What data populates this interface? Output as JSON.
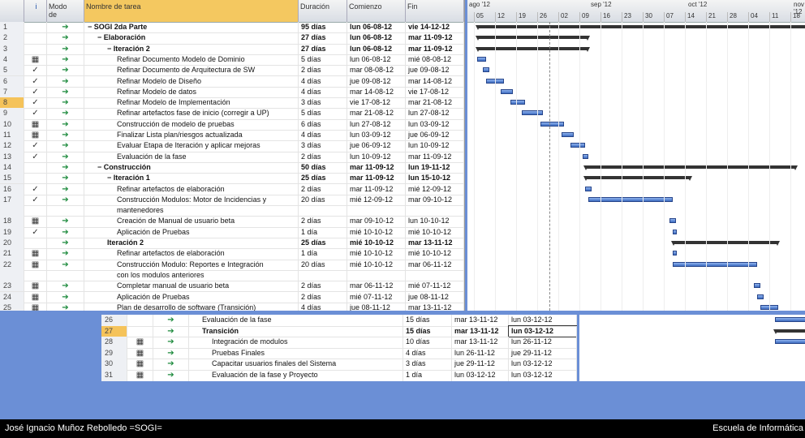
{
  "headers": {
    "info": "i",
    "mode": "Modo\nde",
    "name": "Nombre de tarea",
    "duration": "Duración",
    "start": "Comienzo",
    "end": "Fin"
  },
  "months": [
    "ago '12",
    "sep '12",
    "oct '12",
    "nov '12"
  ],
  "weeks": [
    "05",
    "12",
    "19",
    "26",
    "02",
    "09",
    "16",
    "23",
    "30",
    "07",
    "14",
    "21",
    "28",
    "04",
    "11",
    "18"
  ],
  "rows": [
    {
      "id": "1",
      "mark": "",
      "name": "− SOGI 2da Parte",
      "dur": "95 días",
      "start": "lun 06-08-12",
      "end": "vie 14-12-12",
      "level": 0,
      "sum": true
    },
    {
      "id": "2",
      "mark": "",
      "name": "− Elaboración",
      "dur": "27 días",
      "start": "lun 06-08-12",
      "end": "mar 11-09-12",
      "level": 1,
      "sum": true
    },
    {
      "id": "3",
      "mark": "",
      "name": "− Iteración 2",
      "dur": "27 días",
      "start": "lun 06-08-12",
      "end": "mar 11-09-12",
      "level": 2,
      "sum": true
    },
    {
      "id": "4",
      "mark": "▦",
      "name": "Refinar Documento Modelo de Dominio",
      "dur": "5 días",
      "start": "lun 06-08-12",
      "end": "mié 08-08-12",
      "level": 3
    },
    {
      "id": "5",
      "mark": "✓",
      "name": "Refinar Documento de Arquitectura de SW",
      "dur": "2 días",
      "start": "mar 08-08-12",
      "end": "jue 09-08-12",
      "level": 3
    },
    {
      "id": "6",
      "mark": "✓",
      "name": "Refinar Modelo de Diseño",
      "dur": "4 días",
      "start": "jue 09-08-12",
      "end": "mar 14-08-12",
      "level": 3
    },
    {
      "id": "7",
      "mark": "✓",
      "name": "Refinar Modelo de datos",
      "dur": "4 días",
      "start": "mar 14-08-12",
      "end": "vie 17-08-12",
      "level": 3
    },
    {
      "id": "8",
      "mark": "✓",
      "name": "Refinar Modelo de Implementación",
      "dur": "3 días",
      "start": "vie 17-08-12",
      "end": "mar 21-08-12",
      "level": 3,
      "cur": true
    },
    {
      "id": "9",
      "mark": "✓",
      "name": "Refinar artefactos fase de inicio (corregir a UP)",
      "dur": "5 días",
      "start": "mar 21-08-12",
      "end": "lun 27-08-12",
      "level": 3
    },
    {
      "id": "10",
      "mark": "▦",
      "name": "Construcción de modelo de pruebas",
      "dur": "6 días",
      "start": "lun 27-08-12",
      "end": "lun 03-09-12",
      "level": 3
    },
    {
      "id": "11",
      "mark": "▦",
      "name": "Finalizar Lista plan/riesgos actualizada",
      "dur": "4 días",
      "start": "lun 03-09-12",
      "end": "jue 06-09-12",
      "level": 3
    },
    {
      "id": "12",
      "mark": "✓",
      "name": "Evaluar Etapa de Iteración y aplicar mejoras",
      "dur": "3 días",
      "start": "jue 06-09-12",
      "end": "lun 10-09-12",
      "level": 3
    },
    {
      "id": "13",
      "mark": "✓",
      "name": "Evaluación de la fase",
      "dur": "2 días",
      "start": "lun 10-09-12",
      "end": "mar 11-09-12",
      "level": 3
    },
    {
      "id": "14",
      "mark": "",
      "name": "− Construcción",
      "dur": "50 días",
      "start": "mar 11-09-12",
      "end": "lun 19-11-12",
      "level": 1,
      "sum": true
    },
    {
      "id": "15",
      "mark": "",
      "name": "− Iteración 1",
      "dur": "25 días",
      "start": "mar 11-09-12",
      "end": "lun 15-10-12",
      "level": 2,
      "sum": true
    },
    {
      "id": "16",
      "mark": "✓",
      "name": "Refinar artefactos de elaboración",
      "dur": "2 días",
      "start": "mar 11-09-12",
      "end": "mié 12-09-12",
      "level": 3
    },
    {
      "id": "17",
      "mark": "✓",
      "name": "Construcción Modulos: Motor de Incidencias y",
      "dur": "20 días",
      "start": "mié 12-09-12",
      "end": "mar 09-10-12",
      "level": 3
    },
    {
      "id": "",
      "mark": "",
      "name": "mantenedores",
      "dur": "",
      "start": "",
      "end": "",
      "level": 3
    },
    {
      "id": "18",
      "mark": "▦",
      "name": "Creación de Manual de usuario beta",
      "dur": "2 días",
      "start": "mar 09-10-12",
      "end": "lun 10-10-12",
      "level": 3
    },
    {
      "id": "19",
      "mark": "✓",
      "name": "Aplicación de Pruebas",
      "dur": "1 día",
      "start": "mié 10-10-12",
      "end": "mié 10-10-12",
      "level": 3
    },
    {
      "id": "20",
      "mark": "",
      "name": "Iteración 2",
      "dur": "25 días",
      "start": "mié 10-10-12",
      "end": "mar 13-11-12",
      "level": 2,
      "sum": true
    },
    {
      "id": "21",
      "mark": "▦",
      "name": "Refinar artefactos de elaboración",
      "dur": "1 día",
      "start": "mié 10-10-12",
      "end": "mié 10-10-12",
      "level": 3
    },
    {
      "id": "22",
      "mark": "▦",
      "name": "Construcción Modulo: Reportes e Integración",
      "dur": "20 días",
      "start": "mié 10-10-12",
      "end": "mar 06-11-12",
      "level": 3
    },
    {
      "id": "",
      "mark": "",
      "name": "con los modulos anteriores",
      "dur": "",
      "start": "",
      "end": "",
      "level": 3
    },
    {
      "id": "23",
      "mark": "▦",
      "name": "Completar manual de usuario beta",
      "dur": "2 días",
      "start": "mar 06-11-12",
      "end": "mié 07-11-12",
      "level": 3
    },
    {
      "id": "24",
      "mark": "▦",
      "name": "Aplicación de Pruebas",
      "dur": "2 días",
      "start": "mié 07-11-12",
      "end": "jue 08-11-12",
      "level": 3
    },
    {
      "id": "25",
      "mark": "▦",
      "name": "Plan de desarrollo de software (Transición)",
      "dur": "4 días",
      "start": "jue 08-11-12",
      "end": "mar 13-11-12",
      "level": 3
    }
  ],
  "bottom_rows": [
    {
      "id": "26",
      "mark": "",
      "name": "Evaluación de la fase",
      "dur": "15 días",
      "start": "mar 13-11-12",
      "end": "lun 03-12-12",
      "level": 1,
      "sum": false
    },
    {
      "id": "27",
      "mark": "",
      "name": "Transición",
      "dur": "15 días",
      "start": "mar 13-11-12",
      "end": "lun 03-12-12",
      "level": 1,
      "sum": true,
      "cur": true
    },
    {
      "id": "28",
      "mark": "▦",
      "name": "Integración de modulos",
      "dur": "10 días",
      "start": "mar 13-11-12",
      "end": "lun 26-11-12",
      "level": 2
    },
    {
      "id": "29",
      "mark": "▦",
      "name": "Pruebas Finales",
      "dur": "4 días",
      "start": "lun 26-11-12",
      "end": "jue 29-11-12",
      "level": 2
    },
    {
      "id": "30",
      "mark": "▦",
      "name": "Capacitar usuarios finales del Sistema",
      "dur": "3 días",
      "start": "jue 29-11-12",
      "end": "lun 03-12-12",
      "level": 2
    },
    {
      "id": "31",
      "mark": "▦",
      "name": "Evaluación de la fase y Proyecto",
      "dur": "1 día",
      "start": "lun 03-12-12",
      "end": "lun 03-12-12",
      "level": 2
    }
  ],
  "footer": {
    "left": "José Ignacio Muñoz Rebolledo =SOGI=",
    "right": "Escuela de Informática"
  },
  "colors": {
    "bar": "#3d6cc0",
    "summary": "#333333",
    "selected": "#f5c35a"
  }
}
